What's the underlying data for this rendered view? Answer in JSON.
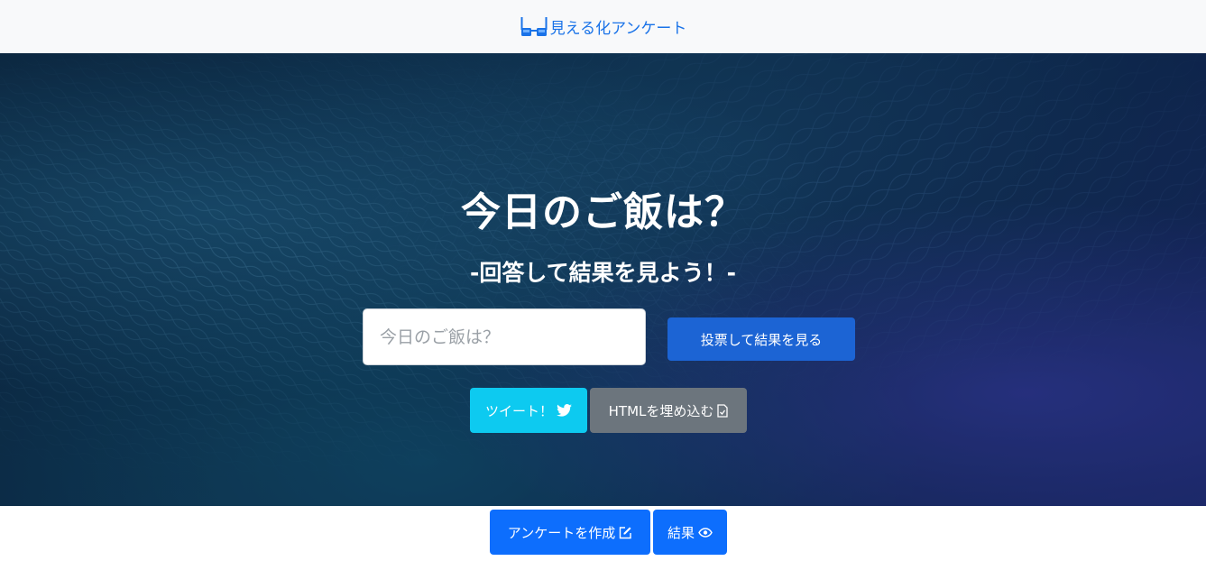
{
  "header": {
    "brand_text": "見える化アンケート",
    "brand_icon": "glasses-icon"
  },
  "hero": {
    "title": "今日のご飯は？",
    "subtitle": "-回答して結果を見よう！-",
    "answer_input": {
      "placeholder": "今日のご飯は？",
      "value": ""
    },
    "vote_button_label": "投票して結果を見る",
    "tweet_button_label": "ツイート！",
    "tweet_button_icon": "twitter-icon",
    "embed_button_label": "HTMLを埋め込む",
    "embed_button_icon": "file-check-icon"
  },
  "footer": {
    "create_button_label": "アンケートを作成",
    "create_button_icon": "edit-icon",
    "result_button_label": "結果",
    "result_button_icon": "eye-icon"
  },
  "colors": {
    "brand": "#1a73e8",
    "primary": "#0d6efd",
    "vote": "#1c64d4",
    "info": "#0dcaf0",
    "secondary": "#6c757d",
    "navbar_bg": "#f8f9fa"
  }
}
